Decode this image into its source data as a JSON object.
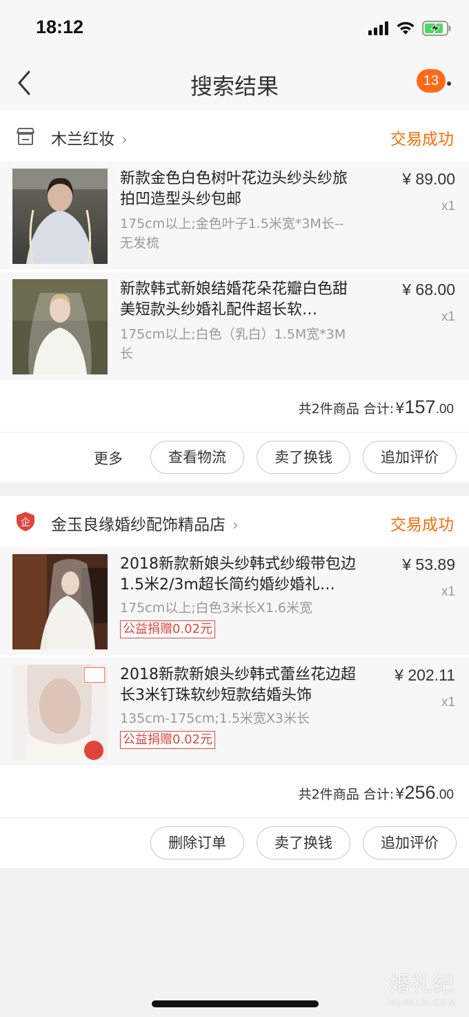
{
  "status_bar": {
    "time": "18:12",
    "icons": [
      "signal-icon",
      "wifi-icon",
      "battery-charging-icon"
    ]
  },
  "nav": {
    "title": "搜索结果",
    "badge_count": "13",
    "icons": [
      "back-icon",
      "more-icon"
    ]
  },
  "orders": [
    {
      "store_name": "木兰红妆",
      "status": "交易成功",
      "store_icon": "shop-icon",
      "items": [
        {
          "title": "新款金色白色树叶花边头纱头纱旅拍凹造型头纱包邮",
          "spec": "175cm以上;金色叶子1.5米宽*3M长--无发梳",
          "price": "¥ 89.00",
          "qty": "x1",
          "charity": ""
        },
        {
          "title": "新款韩式新娘结婚花朵花瓣白色甜美短款头纱婚礼配件超长软…",
          "spec": "175cm以上;白色（乳白）1.5M宽*3M长",
          "price": "¥ 68.00",
          "qty": "x1",
          "charity": ""
        }
      ],
      "total_prefix": "共2件商品 合计:",
      "currency": "¥",
      "total_int": "157",
      "total_dec": ".00",
      "more_label": "更多",
      "actions": [
        "查看物流",
        "卖了换钱",
        "追加评价"
      ]
    },
    {
      "store_name": "金玉良缘婚纱配饰精品店",
      "status": "交易成功",
      "store_icon": "enterprise-shield-icon",
      "store_icon_text": "企",
      "items": [
        {
          "title": "2018新款新娘头纱韩式纱缎带包边1.5米2/3m超长简约婚纱婚礼…",
          "spec": "175cm以上;白色3米长X1.6米宽",
          "price": "¥ 53.89",
          "qty": "x1",
          "charity": "公益捐赠0.02元"
        },
        {
          "title": "2018新款新娘头纱韩式蕾丝花边超长3米钉珠软纱短款结婚头饰",
          "spec": "135cm-175cm;1.5米宽X3米长",
          "price": "¥ 202.11",
          "qty": "x1",
          "charity": "公益捐赠0.02元"
        }
      ],
      "total_prefix": "共2件商品 合计:",
      "currency": "¥",
      "total_int": "256",
      "total_dec": ".00",
      "actions": [
        "删除订单",
        "卖了换钱",
        "追加评价"
      ]
    }
  ],
  "watermark": {
    "cn": "婚礼纪",
    "en": "HUNLIJI.COM"
  },
  "colors": {
    "accent": "#ff6a00",
    "badge": "#ff6a1a",
    "charity": "#e0453a",
    "bg": "#f2f2f2"
  }
}
